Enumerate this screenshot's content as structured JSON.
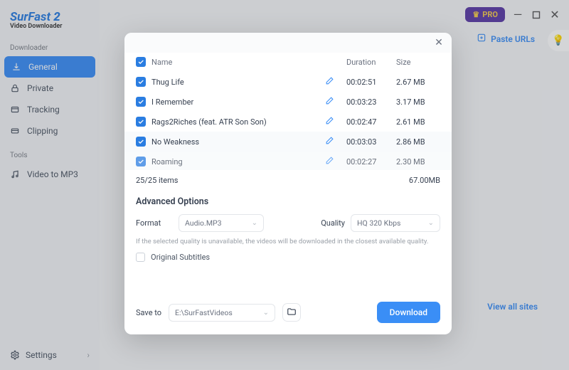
{
  "logo": {
    "brand": "SurFast",
    "version": "2",
    "sub": "Video Downloader"
  },
  "sidebar": {
    "section1": "Downloader",
    "items": [
      {
        "label": "General"
      },
      {
        "label": "Private"
      },
      {
        "label": "Tracking"
      },
      {
        "label": "Clipping"
      }
    ],
    "section2": "Tools",
    "tools": [
      {
        "label": "Video to MP3"
      }
    ],
    "settings": "Settings"
  },
  "header": {
    "pro": "PRO",
    "paste_urls": "Paste URLs",
    "view_all": "View all sites"
  },
  "modal": {
    "columns": {
      "name": "Name",
      "duration": "Duration",
      "size": "Size"
    },
    "rows": [
      {
        "name": "Thug Life",
        "duration": "00:02:51",
        "size": "2.67 MB"
      },
      {
        "name": "I Remember",
        "duration": "00:03:23",
        "size": "3.17 MB"
      },
      {
        "name": "Rags2Riches (feat. ATR Son Son)",
        "duration": "00:02:47",
        "size": "2.61 MB"
      },
      {
        "name": "No Weakness",
        "duration": "00:03:03",
        "size": "2.86 MB"
      },
      {
        "name": "Roaming",
        "duration": "00:02:27",
        "size": "2.30 MB"
      }
    ],
    "footer": {
      "count": "25/25 items",
      "total": "67.00MB"
    },
    "advanced": {
      "title": "Advanced Options",
      "format_label": "Format",
      "format_value": "Audio.MP3",
      "quality_label": "Quality",
      "quality_value": "HQ 320 Kbps",
      "note": "If the selected quality is unavailable, the videos will be downloaded in the closest available quality.",
      "original_subtitles": "Original Subtitles"
    },
    "save": {
      "label": "Save to",
      "path": "E:\\SurFastVideos"
    },
    "download": "Download"
  }
}
